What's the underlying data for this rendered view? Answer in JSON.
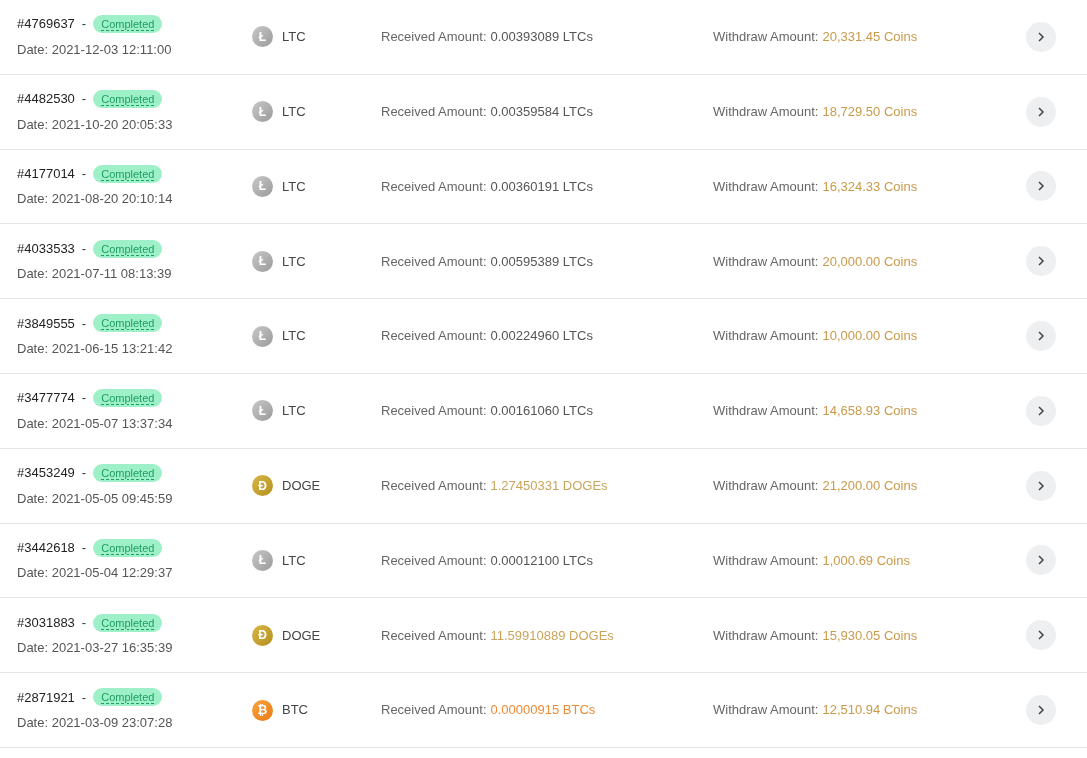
{
  "transactions": [
    {
      "id": "#4769637",
      "separator": "-",
      "status": "Completed",
      "date": "Date: 2021-12-03 12:11:00",
      "coin": {
        "kind": "ltc",
        "symbol": "Ł",
        "name": "LTC"
      },
      "received_label": "Received Amount:",
      "received": "0.00393089 LTCs",
      "withdraw_label": "Withdraw Amount:",
      "withdraw": "20,331.45 Coins"
    },
    {
      "id": "#4482530",
      "separator": "-",
      "status": "Completed",
      "date": "Date: 2021-10-20 20:05:33",
      "coin": {
        "kind": "ltc",
        "symbol": "Ł",
        "name": "LTC"
      },
      "received_label": "Received Amount:",
      "received": "0.00359584 LTCs",
      "withdraw_label": "Withdraw Amount:",
      "withdraw": "18,729.50 Coins"
    },
    {
      "id": "#4177014",
      "separator": "-",
      "status": "Completed",
      "date": "Date: 2021-08-20 20:10:14",
      "coin": {
        "kind": "ltc",
        "symbol": "Ł",
        "name": "LTC"
      },
      "received_label": "Received Amount:",
      "received": "0.00360191 LTCs",
      "withdraw_label": "Withdraw Amount:",
      "withdraw": "16,324.33 Coins"
    },
    {
      "id": "#4033533",
      "separator": "-",
      "status": "Completed",
      "date": "Date: 2021-07-11 08:13:39",
      "coin": {
        "kind": "ltc",
        "symbol": "Ł",
        "name": "LTC"
      },
      "received_label": "Received Amount:",
      "received": "0.00595389 LTCs",
      "withdraw_label": "Withdraw Amount:",
      "withdraw": "20,000.00 Coins"
    },
    {
      "id": "#3849555",
      "separator": "-",
      "status": "Completed",
      "date": "Date: 2021-06-15 13:21:42",
      "coin": {
        "kind": "ltc",
        "symbol": "Ł",
        "name": "LTC"
      },
      "received_label": "Received Amount:",
      "received": "0.00224960 LTCs",
      "withdraw_label": "Withdraw Amount:",
      "withdraw": "10,000.00 Coins"
    },
    {
      "id": "#3477774",
      "separator": "-",
      "status": "Completed",
      "date": "Date: 2021-05-07 13:37:34",
      "coin": {
        "kind": "ltc",
        "symbol": "Ł",
        "name": "LTC"
      },
      "received_label": "Received Amount:",
      "received": "0.00161060 LTCs",
      "withdraw_label": "Withdraw Amount:",
      "withdraw": "14,658.93 Coins"
    },
    {
      "id": "#3453249",
      "separator": "-",
      "status": "Completed",
      "date": "Date: 2021-05-05 09:45:59",
      "coin": {
        "kind": "doge",
        "symbol": "Ð",
        "name": "DOGE"
      },
      "received_label": "Received Amount:",
      "received": "1.27450331 DOGEs",
      "withdraw_label": "Withdraw Amount:",
      "withdraw": "21,200.00 Coins"
    },
    {
      "id": "#3442618",
      "separator": "-",
      "status": "Completed",
      "date": "Date: 2021-05-04 12:29:37",
      "coin": {
        "kind": "ltc",
        "symbol": "Ł",
        "name": "LTC"
      },
      "received_label": "Received Amount:",
      "received": "0.00012100 LTCs",
      "withdraw_label": "Withdraw Amount:",
      "withdraw": "1,000.69 Coins"
    },
    {
      "id": "#3031883",
      "separator": "-",
      "status": "Completed",
      "date": "Date: 2021-03-27 16:35:39",
      "coin": {
        "kind": "doge",
        "symbol": "Ð",
        "name": "DOGE"
      },
      "received_label": "Received Amount:",
      "received": "11.59910889 DOGEs",
      "withdraw_label": "Withdraw Amount:",
      "withdraw": "15,930.05 Coins"
    },
    {
      "id": "#2871921",
      "separator": "-",
      "status": "Completed",
      "date": "Date: 2021-03-09 23:07:28",
      "coin": {
        "kind": "btc",
        "symbol": "₿",
        "name": "BTC"
      },
      "received_label": "Received Amount:",
      "received": "0.00000915 BTCs",
      "withdraw_label": "Withdraw Amount:",
      "withdraw": "12,510.94 Coins"
    }
  ]
}
